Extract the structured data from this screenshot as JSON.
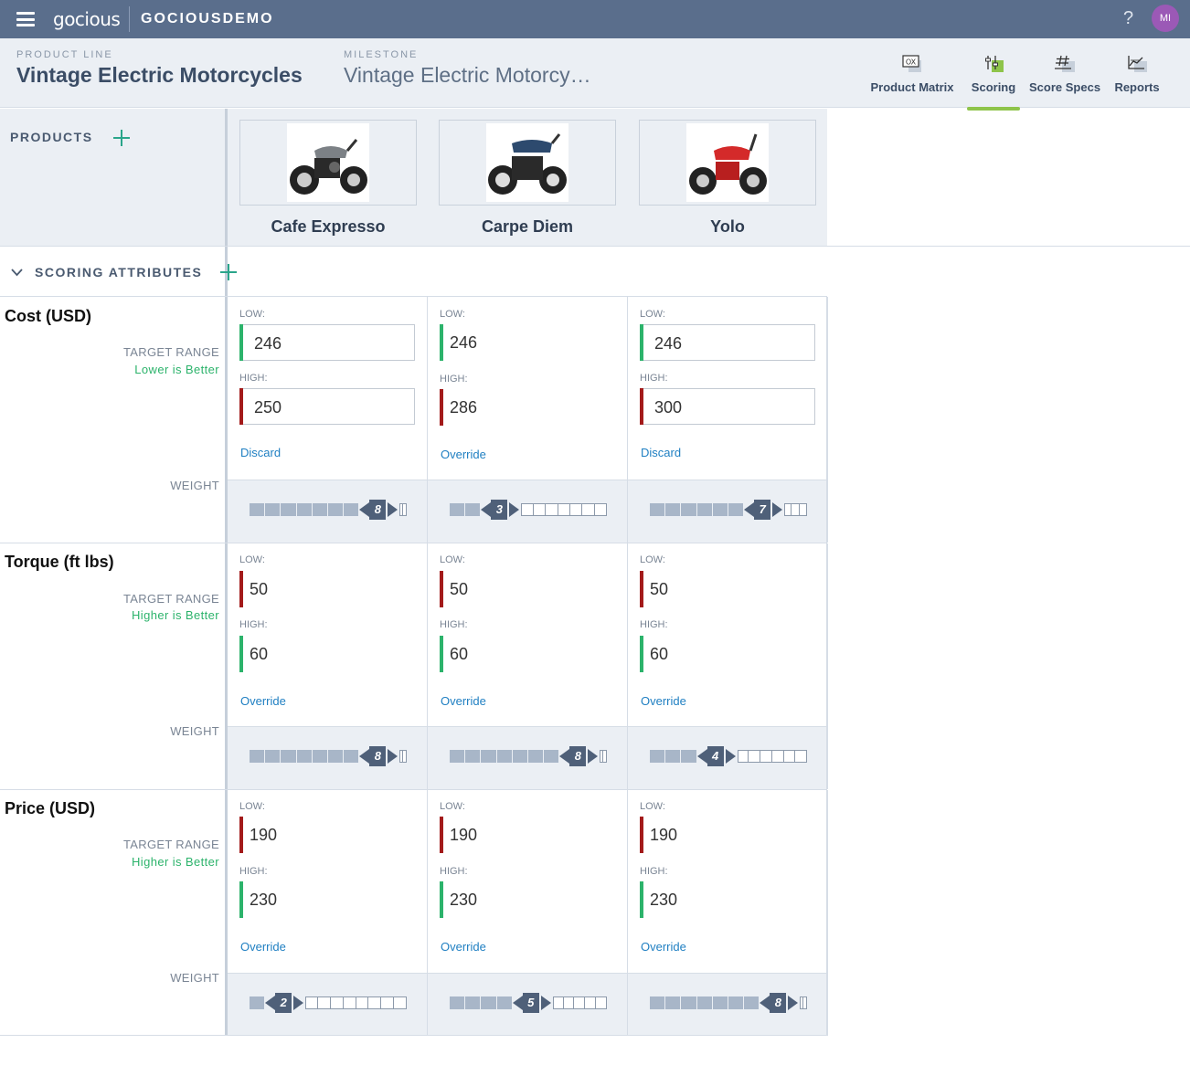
{
  "app": {
    "logo": "gocious",
    "org": "GOCIOUSDEMO",
    "help": "?",
    "avatar": "MI"
  },
  "header": {
    "product_line_label": "PRODUCT LINE",
    "product_line": "Vintage Electric Motorcycles",
    "milestone_label": "MILESTONE",
    "milestone": "Vintage Electric Motorcy…"
  },
  "nav_tabs": [
    {
      "label": "Product Matrix",
      "icon": "matrix-icon",
      "active": false
    },
    {
      "label": "Scoring",
      "icon": "sliders-icon",
      "active": true
    },
    {
      "label": "Score Specs",
      "icon": "hash-icon",
      "active": false
    },
    {
      "label": "Reports",
      "icon": "chart-icon",
      "active": false
    }
  ],
  "products_title": "PRODUCTS",
  "products": [
    {
      "name": "Cafe Expresso",
      "tank_color": "#7c8186"
    },
    {
      "name": "Carpe Diem",
      "tank_color": "#2d4a6e"
    },
    {
      "name": "Yolo",
      "tank_color": "#d42a2a"
    }
  ],
  "scoring_title": "SCORING ATTRIBUTES",
  "labels": {
    "target_range": "TARGET RANGE",
    "weight": "WEIGHT",
    "low": "LOW:",
    "high": "HIGH:"
  },
  "colors": {
    "good": "#2cb36b",
    "bad": "#a31a1a",
    "link": "#1f7fc2"
  },
  "attributes": [
    {
      "name": "Cost (USD)",
      "rule": "Lower is Better",
      "cells": [
        {
          "low": "246",
          "high": "250",
          "editable": true,
          "action": "Discard",
          "weight": 8
        },
        {
          "low": "246",
          "high": "286",
          "editable": false,
          "action": "Override",
          "weight": 3
        },
        {
          "low": "246",
          "high": "300",
          "editable": true,
          "action": "Discard",
          "weight": 7
        }
      ]
    },
    {
      "name": "Torque (ft lbs)",
      "rule": "Higher is Better",
      "cells": [
        {
          "low": "50",
          "high": "60",
          "editable": false,
          "action": "Override",
          "weight": 8
        },
        {
          "low": "50",
          "high": "60",
          "editable": false,
          "action": "Override",
          "weight": 8
        },
        {
          "low": "50",
          "high": "60",
          "editable": false,
          "action": "Override",
          "weight": 4
        }
      ]
    },
    {
      "name": "Price (USD)",
      "rule": "Higher is Better",
      "cells": [
        {
          "low": "190",
          "high": "230",
          "editable": false,
          "action": "Override",
          "weight": 2
        },
        {
          "low": "190",
          "high": "230",
          "editable": false,
          "action": "Override",
          "weight": 5
        },
        {
          "low": "190",
          "high": "230",
          "editable": false,
          "action": "Override",
          "weight": 8
        }
      ]
    }
  ],
  "weight_max": 10
}
